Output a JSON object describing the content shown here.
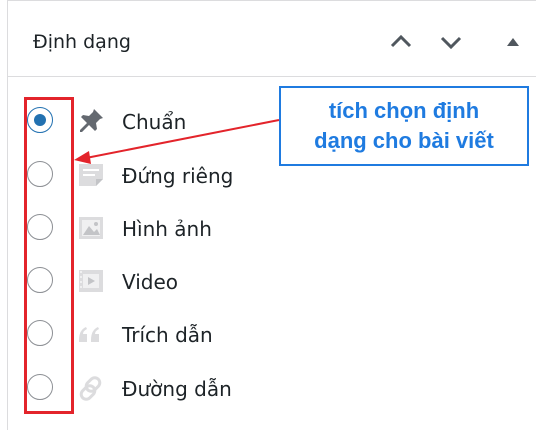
{
  "panel": {
    "title": "Định dạng",
    "buttons": [
      {
        "name": "move-up",
        "icon": "chevron-up-icon"
      },
      {
        "name": "move-down",
        "icon": "chevron-down-icon"
      },
      {
        "name": "toggle-panel",
        "icon": "caret-up-icon"
      }
    ]
  },
  "formats": [
    {
      "label": "Chuẩn",
      "icon": "pin-icon",
      "checked": true
    },
    {
      "label": "Đứng riêng",
      "icon": "aside-icon",
      "checked": false
    },
    {
      "label": "Hình ảnh",
      "icon": "image-icon",
      "checked": false
    },
    {
      "label": "Video",
      "icon": "video-icon",
      "checked": false
    },
    {
      "label": "Trích dẫn",
      "icon": "quote-icon",
      "checked": false
    },
    {
      "label": "Đường dẫn",
      "icon": "link-icon",
      "checked": false
    }
  ],
  "annotation": {
    "line1": "tích chọn định",
    "line2": "dạng cho bài viết",
    "box_color": "#e3242b",
    "text_color": "#1f7be0"
  }
}
